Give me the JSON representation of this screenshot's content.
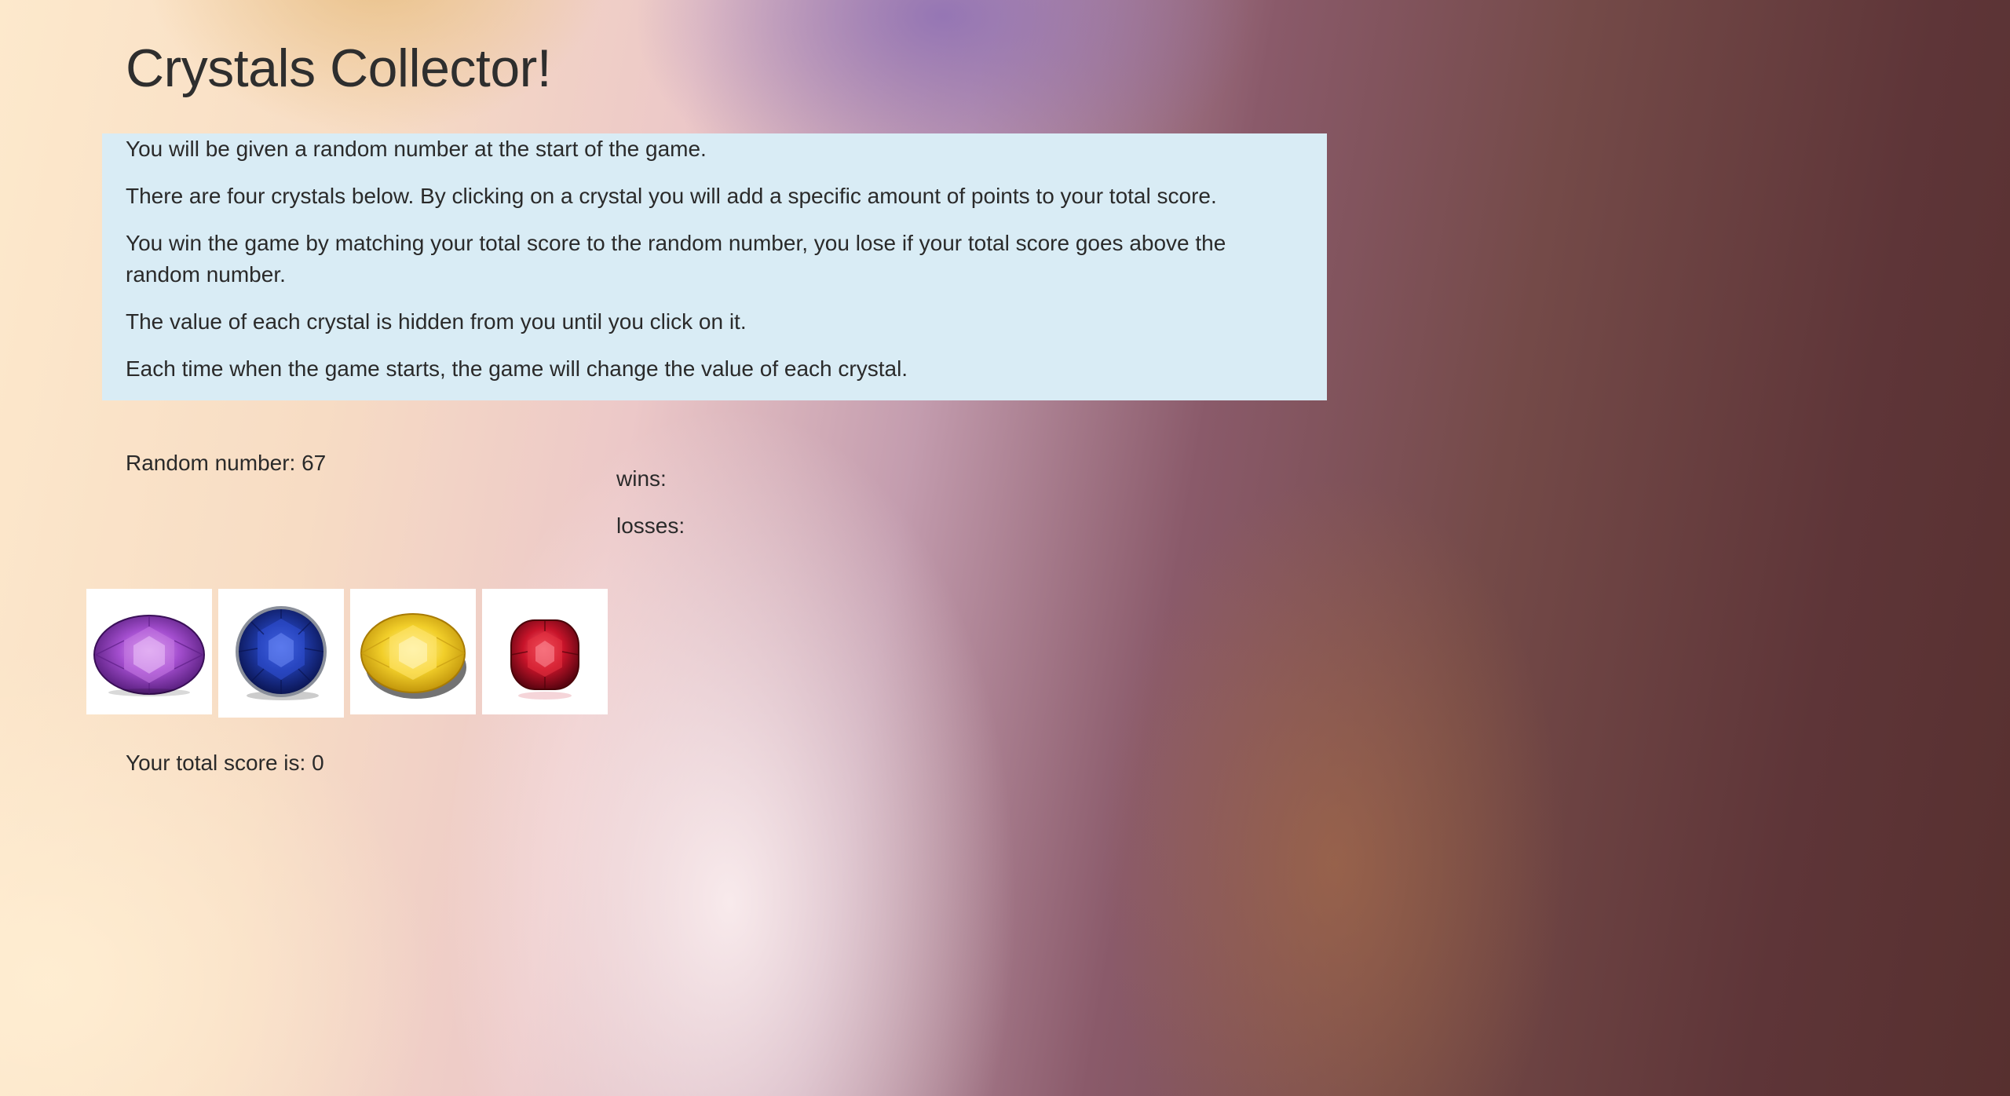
{
  "page": {
    "title": "Crystals Collector!"
  },
  "instructions": [
    "You will be given a random number at the start of the game.",
    "There are four crystals below. By clicking on a crystal you will add a specific amount of points to your total score.",
    "You win the game by matching your total score to the random number, you lose if your total score goes above the random number.",
    "The value of each crystal is hidden from you until you click on it.",
    "Each time when the game starts, the game will change the value of each crystal."
  ],
  "game": {
    "random_number_text": "Random number: 67",
    "random_number": 67,
    "wins_text": "wins:",
    "losses_text": "losses:",
    "total_score_text": "Your total score is: 0",
    "total_score": 0
  },
  "crystals": [
    {
      "icon": "purple-amethyst-crystal-icon",
      "color": "#8e3fbf"
    },
    {
      "icon": "blue-sapphire-crystal-icon",
      "color": "#1f3aa8"
    },
    {
      "icon": "yellow-citrine-crystal-icon",
      "color": "#f2cf2a"
    },
    {
      "icon": "red-ruby-crystal-icon",
      "color": "#c8142a"
    }
  ]
}
